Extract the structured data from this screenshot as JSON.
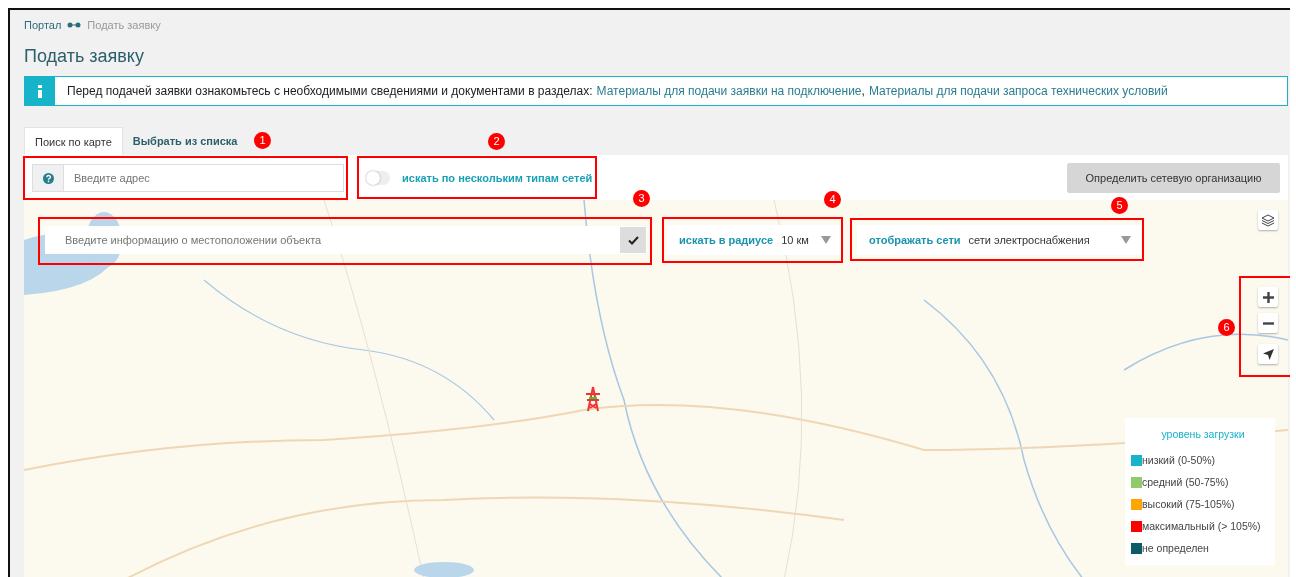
{
  "breadcrumb": [
    {
      "label": "Портал",
      "current": false
    },
    {
      "label": "Подать заявку",
      "current": true
    }
  ],
  "title": "Подать заявку",
  "info": {
    "text": "Перед подачей заявки ознакомьтесь с необходимыми сведениями и документами в разделах:",
    "links": [
      {
        "label": "Материалы для подачи заявки на подключение",
        "after": ","
      },
      {
        "label": "Материалы для подачи запроса технических условий"
      }
    ]
  },
  "tabs": [
    {
      "label": "Поиск по карте",
      "selected": true
    },
    {
      "label": "Выбрать из списка",
      "selected": false
    }
  ],
  "address_field": {
    "placeholder": "Введите адрес"
  },
  "multi_network": {
    "label": "искать по нескольким типам сетей",
    "on": false
  },
  "determine_button": {
    "label": "Определить сетевую организацию"
  },
  "map": {
    "kind": "picture",
    "location_field": {
      "placeholder": "Введите информацию о местоположении объекта"
    },
    "radius": {
      "label": "искать в радиусе",
      "value": "10 км"
    },
    "networks": {
      "label": "отображать сети",
      "value": "сети электроснабжения"
    },
    "legend": {
      "title": "уровень загрузки",
      "items": [
        {
          "label": "низкий (0-50%)",
          "color": "#17b3c9"
        },
        {
          "label": "средний (50-75%)",
          "color": "#8fcb6b"
        },
        {
          "label": "высокий (75-105%)",
          "color": "#ffa500"
        },
        {
          "label": "максимальный (> 105%)",
          "color": "#ff0000"
        },
        {
          "label": "не определен",
          "color": "#0d5b67"
        }
      ]
    }
  },
  "annotations": [
    {
      "number": "1"
    },
    {
      "number": "2"
    },
    {
      "number": "3"
    },
    {
      "number": "4"
    },
    {
      "number": "5"
    },
    {
      "number": "6"
    }
  ]
}
